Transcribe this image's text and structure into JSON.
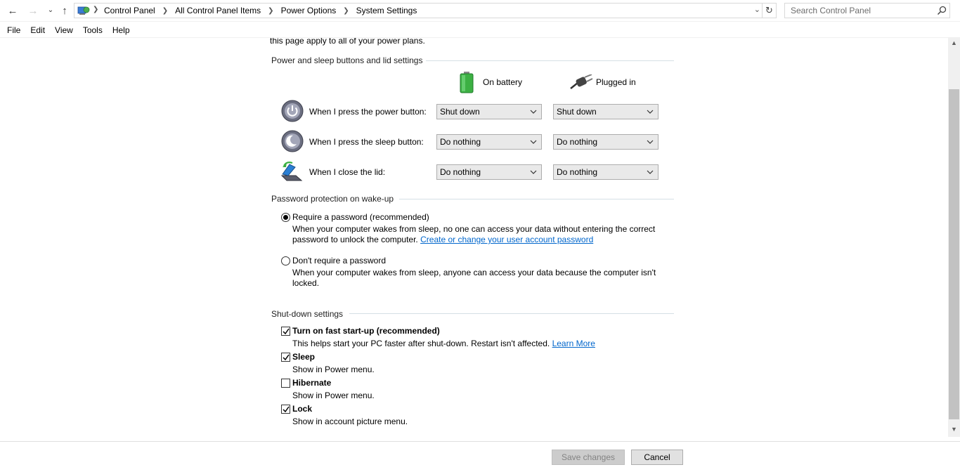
{
  "address_bar": {
    "breadcrumb": [
      "Control Panel",
      "All Control Panel Items",
      "Power Options",
      "System Settings"
    ],
    "search_placeholder": "Search Control Panel"
  },
  "menu": [
    "File",
    "Edit",
    "View",
    "Tools",
    "Help"
  ],
  "intro_text": "this page apply to all of your power plans.",
  "power_buttons": {
    "heading": "Power and sleep buttons and lid settings",
    "col_battery": "On battery",
    "col_plugged": "Plugged in",
    "rows": [
      {
        "label": "When I press the power button:",
        "battery": "Shut down",
        "plugged": "Shut down"
      },
      {
        "label": "When I press the sleep button:",
        "battery": "Do nothing",
        "plugged": "Do nothing"
      },
      {
        "label": "When I close the lid:",
        "battery": "Do nothing",
        "plugged": "Do nothing"
      }
    ]
  },
  "password": {
    "heading": "Password protection on wake-up",
    "option1": {
      "label": "Require a password (recommended)",
      "desc1": "When your computer wakes from sleep, no one can access your data without entering the correct",
      "desc2": "password to unlock the computer.",
      "link": "Create or change your user account password",
      "checked": true
    },
    "option2": {
      "label": "Don't require a password",
      "desc1": "When your computer wakes from sleep, anyone can access your data because the computer isn't",
      "desc2": "locked.",
      "checked": false
    }
  },
  "shutdown": {
    "heading": "Shut-down settings",
    "items": [
      {
        "label": "Turn on fast start-up (recommended)",
        "desc": "This helps start your PC faster after shut-down. Restart isn't affected.",
        "link": "Learn More",
        "checked": true
      },
      {
        "label": "Sleep",
        "desc": "Show in Power menu.",
        "checked": true
      },
      {
        "label": "Hibernate",
        "desc": "Show in Power menu.",
        "checked": false
      },
      {
        "label": "Lock",
        "desc": "Show in account picture menu.",
        "checked": true
      }
    ]
  },
  "buttons": {
    "save": "Save changes",
    "cancel": "Cancel"
  },
  "colors": {
    "link": "#0066cc",
    "section_line": "#d5dfe5",
    "battery_green": "#3cb043"
  }
}
